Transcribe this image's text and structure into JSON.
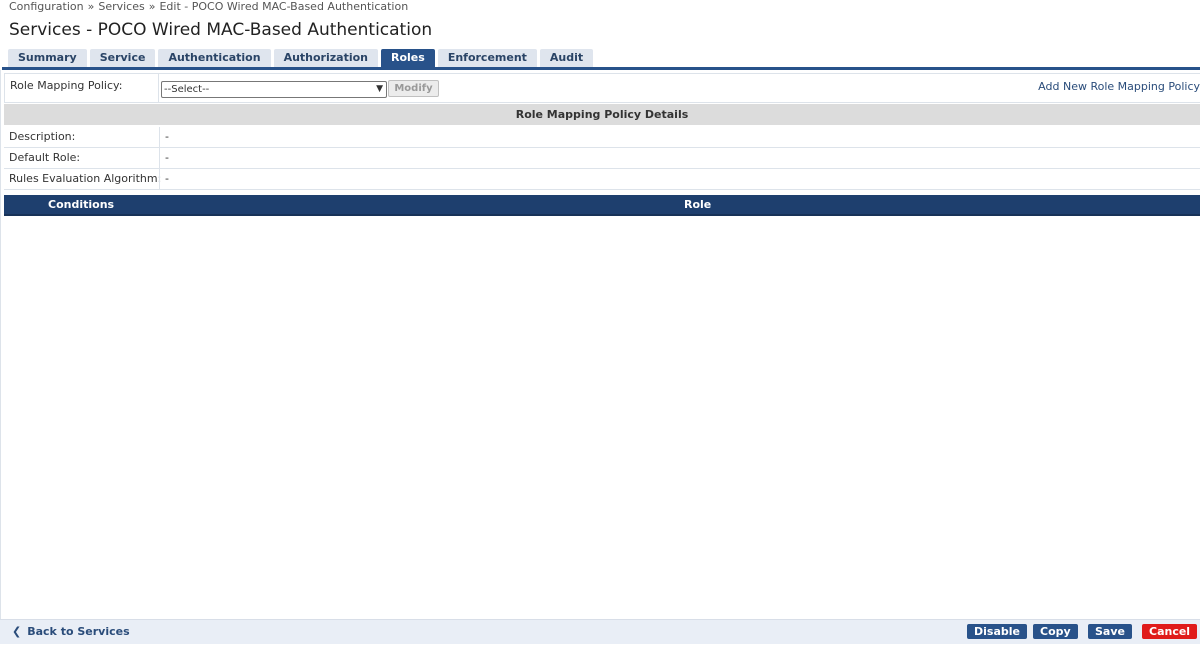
{
  "breadcrumb": {
    "items": [
      "Configuration",
      "Services",
      "Edit - POCO Wired MAC-Based Authentication"
    ],
    "separator": "»"
  },
  "page_title": "Services - POCO Wired MAC-Based Authentication",
  "tabs": [
    {
      "label": "Summary",
      "active": false
    },
    {
      "label": "Service",
      "active": false
    },
    {
      "label": "Authentication",
      "active": false
    },
    {
      "label": "Authorization",
      "active": false
    },
    {
      "label": "Roles",
      "active": true
    },
    {
      "label": "Enforcement",
      "active": false
    },
    {
      "label": "Audit",
      "active": false
    }
  ],
  "role_mapping": {
    "label": "Role Mapping Policy:",
    "select_value": "--Select--",
    "modify_label": "Modify",
    "add_new_link": "Add New Role Mapping Policy"
  },
  "details": {
    "header": "Role Mapping Policy Details",
    "rows": [
      {
        "key": "Description:",
        "value": "-"
      },
      {
        "key": "Default Role:",
        "value": "-"
      },
      {
        "key": "Rules Evaluation Algorithm:",
        "value": "-"
      }
    ]
  },
  "rules_table": {
    "columns": [
      "Conditions",
      "Role"
    ],
    "rows": []
  },
  "footer": {
    "back_label": "Back to Services",
    "disable_label": "Disable",
    "copy_label": "Copy",
    "save_label": "Save",
    "cancel_label": "Cancel"
  },
  "colors": {
    "accent": "#28528a",
    "header_dark": "#1e3f6e",
    "cancel": "#e01b1b",
    "tab_inactive": "#dfe5ee"
  }
}
